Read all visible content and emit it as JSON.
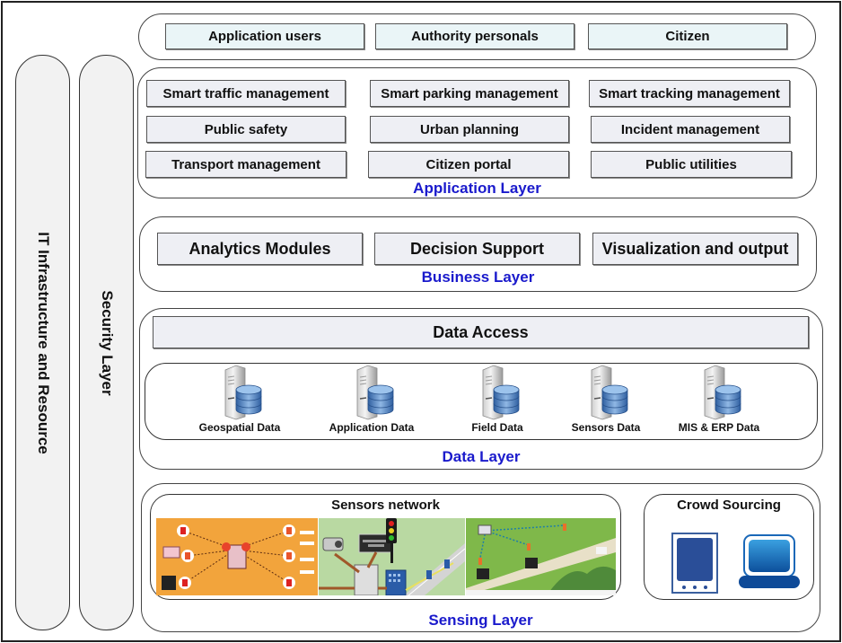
{
  "pillars": {
    "it_infrastructure": "IT Infrastructure and Resource",
    "security": "Security Layer"
  },
  "users_layer": {
    "items": [
      "Application users",
      "Authority personals",
      "Citizen"
    ]
  },
  "application_layer": {
    "title": "Application Layer",
    "items": [
      "Smart traffic management",
      "Smart parking management",
      "Smart tracking management",
      "Public safety",
      "Urban planning",
      "Incident management",
      "Transport management",
      "Citizen portal",
      "Public utilities"
    ]
  },
  "business_layer": {
    "title": "Business Layer",
    "items": [
      "Analytics Modules",
      "Decision Support",
      "Visualization and output"
    ]
  },
  "data_layer": {
    "title": "Data Layer",
    "access": "Data Access",
    "sources": [
      {
        "label": "Geospatial Data",
        "icon": "database-server-icon"
      },
      {
        "label": "Application Data",
        "icon": "database-server-icon"
      },
      {
        "label": "Field Data",
        "icon": "database-server-icon"
      },
      {
        "label": "Sensors Data",
        "icon": "database-server-icon"
      },
      {
        "label": "MIS & ERP Data",
        "icon": "database-server-icon"
      }
    ]
  },
  "sensing_layer": {
    "title": "Sensing Layer",
    "sensors_network": {
      "title": "Sensors network",
      "images": [
        "traffic-management-network-image",
        "traffic-light-control-image",
        "variable-message-sign-network-image"
      ]
    },
    "crowd_sourcing": {
      "title": "Crowd Sourcing",
      "devices": [
        "tablet-icon",
        "laptop-icon"
      ]
    }
  },
  "colors": {
    "layer_title": "#1a1acc",
    "box_fill": "#eeeff4",
    "user_box_fill": "#eaf5f7",
    "pillar_fill": "#f2f2f2",
    "device_blue": "#1f4a9c"
  }
}
